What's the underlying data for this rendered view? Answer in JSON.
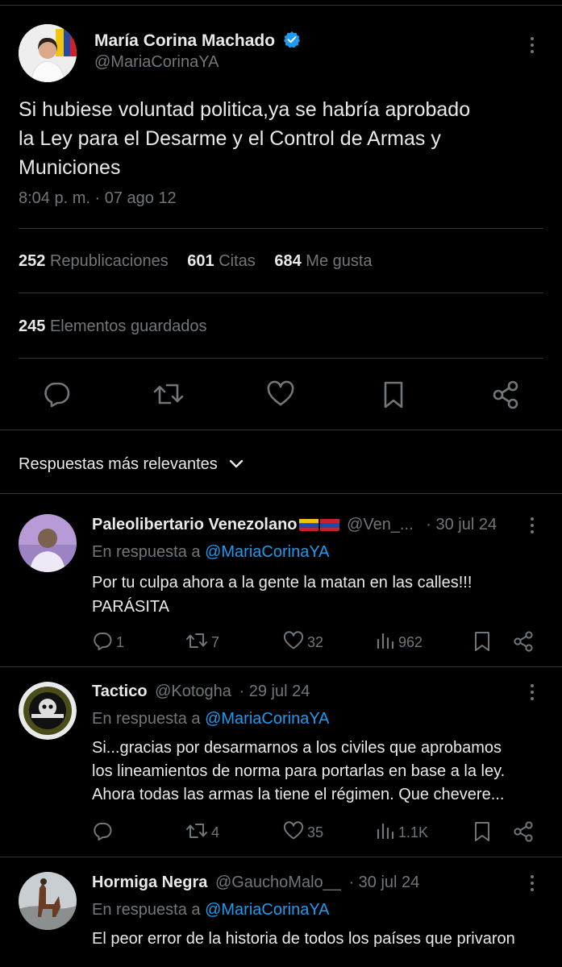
{
  "main_tweet": {
    "author_name": "María Corina Machado",
    "author_handle": "@MariaCorinaYA",
    "text_line1": "Si hubiese voluntad politica,ya se habría aprobado",
    "text_line2": "la Ley para el Desarme y el Control de Armas y",
    "text_line3": "Municiones",
    "timestamp": "8:04 p. m. · 07 ago 12",
    "stats": {
      "reposts_count": "252",
      "reposts_label": "Republicaciones",
      "quotes_count": "601",
      "quotes_label": "Citas",
      "likes_count": "684",
      "likes_label": "Me gusta",
      "bookmarks_count": "245",
      "bookmarks_label": "Elementos guardados"
    }
  },
  "replies_sort": {
    "label": "Respuestas más relevantes"
  },
  "replies": [
    {
      "name": "Paleolibertario Venezolano",
      "handle": "@Ven_...",
      "date": "· 30 jul 24",
      "in_reply_prefix": "En respuesta a",
      "in_reply_handle": "@MariaCorinaYA",
      "line1": "Por tu culpa ahora a la gente la matan en las calles!!!",
      "line2": "PARÁSITA",
      "line3": "",
      "replies": "1",
      "reposts": "7",
      "likes": "32",
      "views": "962"
    },
    {
      "name": "Tactico",
      "handle": "@Kotogha",
      "date": "· 29 jul 24",
      "in_reply_prefix": "En respuesta a",
      "in_reply_handle": "@MariaCorinaYA",
      "line1": "Si...gracias por desarmarnos a los civiles que aprobamos",
      "line2": "los lineamientos de norma para portarlas en base a la ley.",
      "line3": "Ahora todas las armas la tiene el régimen. Que chevere...",
      "replies": "",
      "reposts": "4",
      "likes": "35",
      "views": "1.1K"
    },
    {
      "name": "Hormiga Negra",
      "handle": "@GauchoMalo__",
      "date": "· 30 jul 24",
      "in_reply_prefix": "En respuesta a",
      "in_reply_handle": "@MariaCorinaYA",
      "line1": "El peor error de la historia de todos los países que privaron"
    }
  ],
  "icons": {
    "verified": "verified-badge-icon",
    "reply": "reply-icon",
    "repost": "repost-icon",
    "like": "heart-icon",
    "bookmark": "bookmark-icon",
    "share": "share-icon",
    "views": "views-icon",
    "more": "more-icon",
    "chevron": "chevron-down-icon"
  },
  "colors": {
    "background": "#000000",
    "text": "#e7e9ea",
    "muted": "#71767b",
    "link": "#1d9bf0",
    "divider": "#2f3336"
  }
}
